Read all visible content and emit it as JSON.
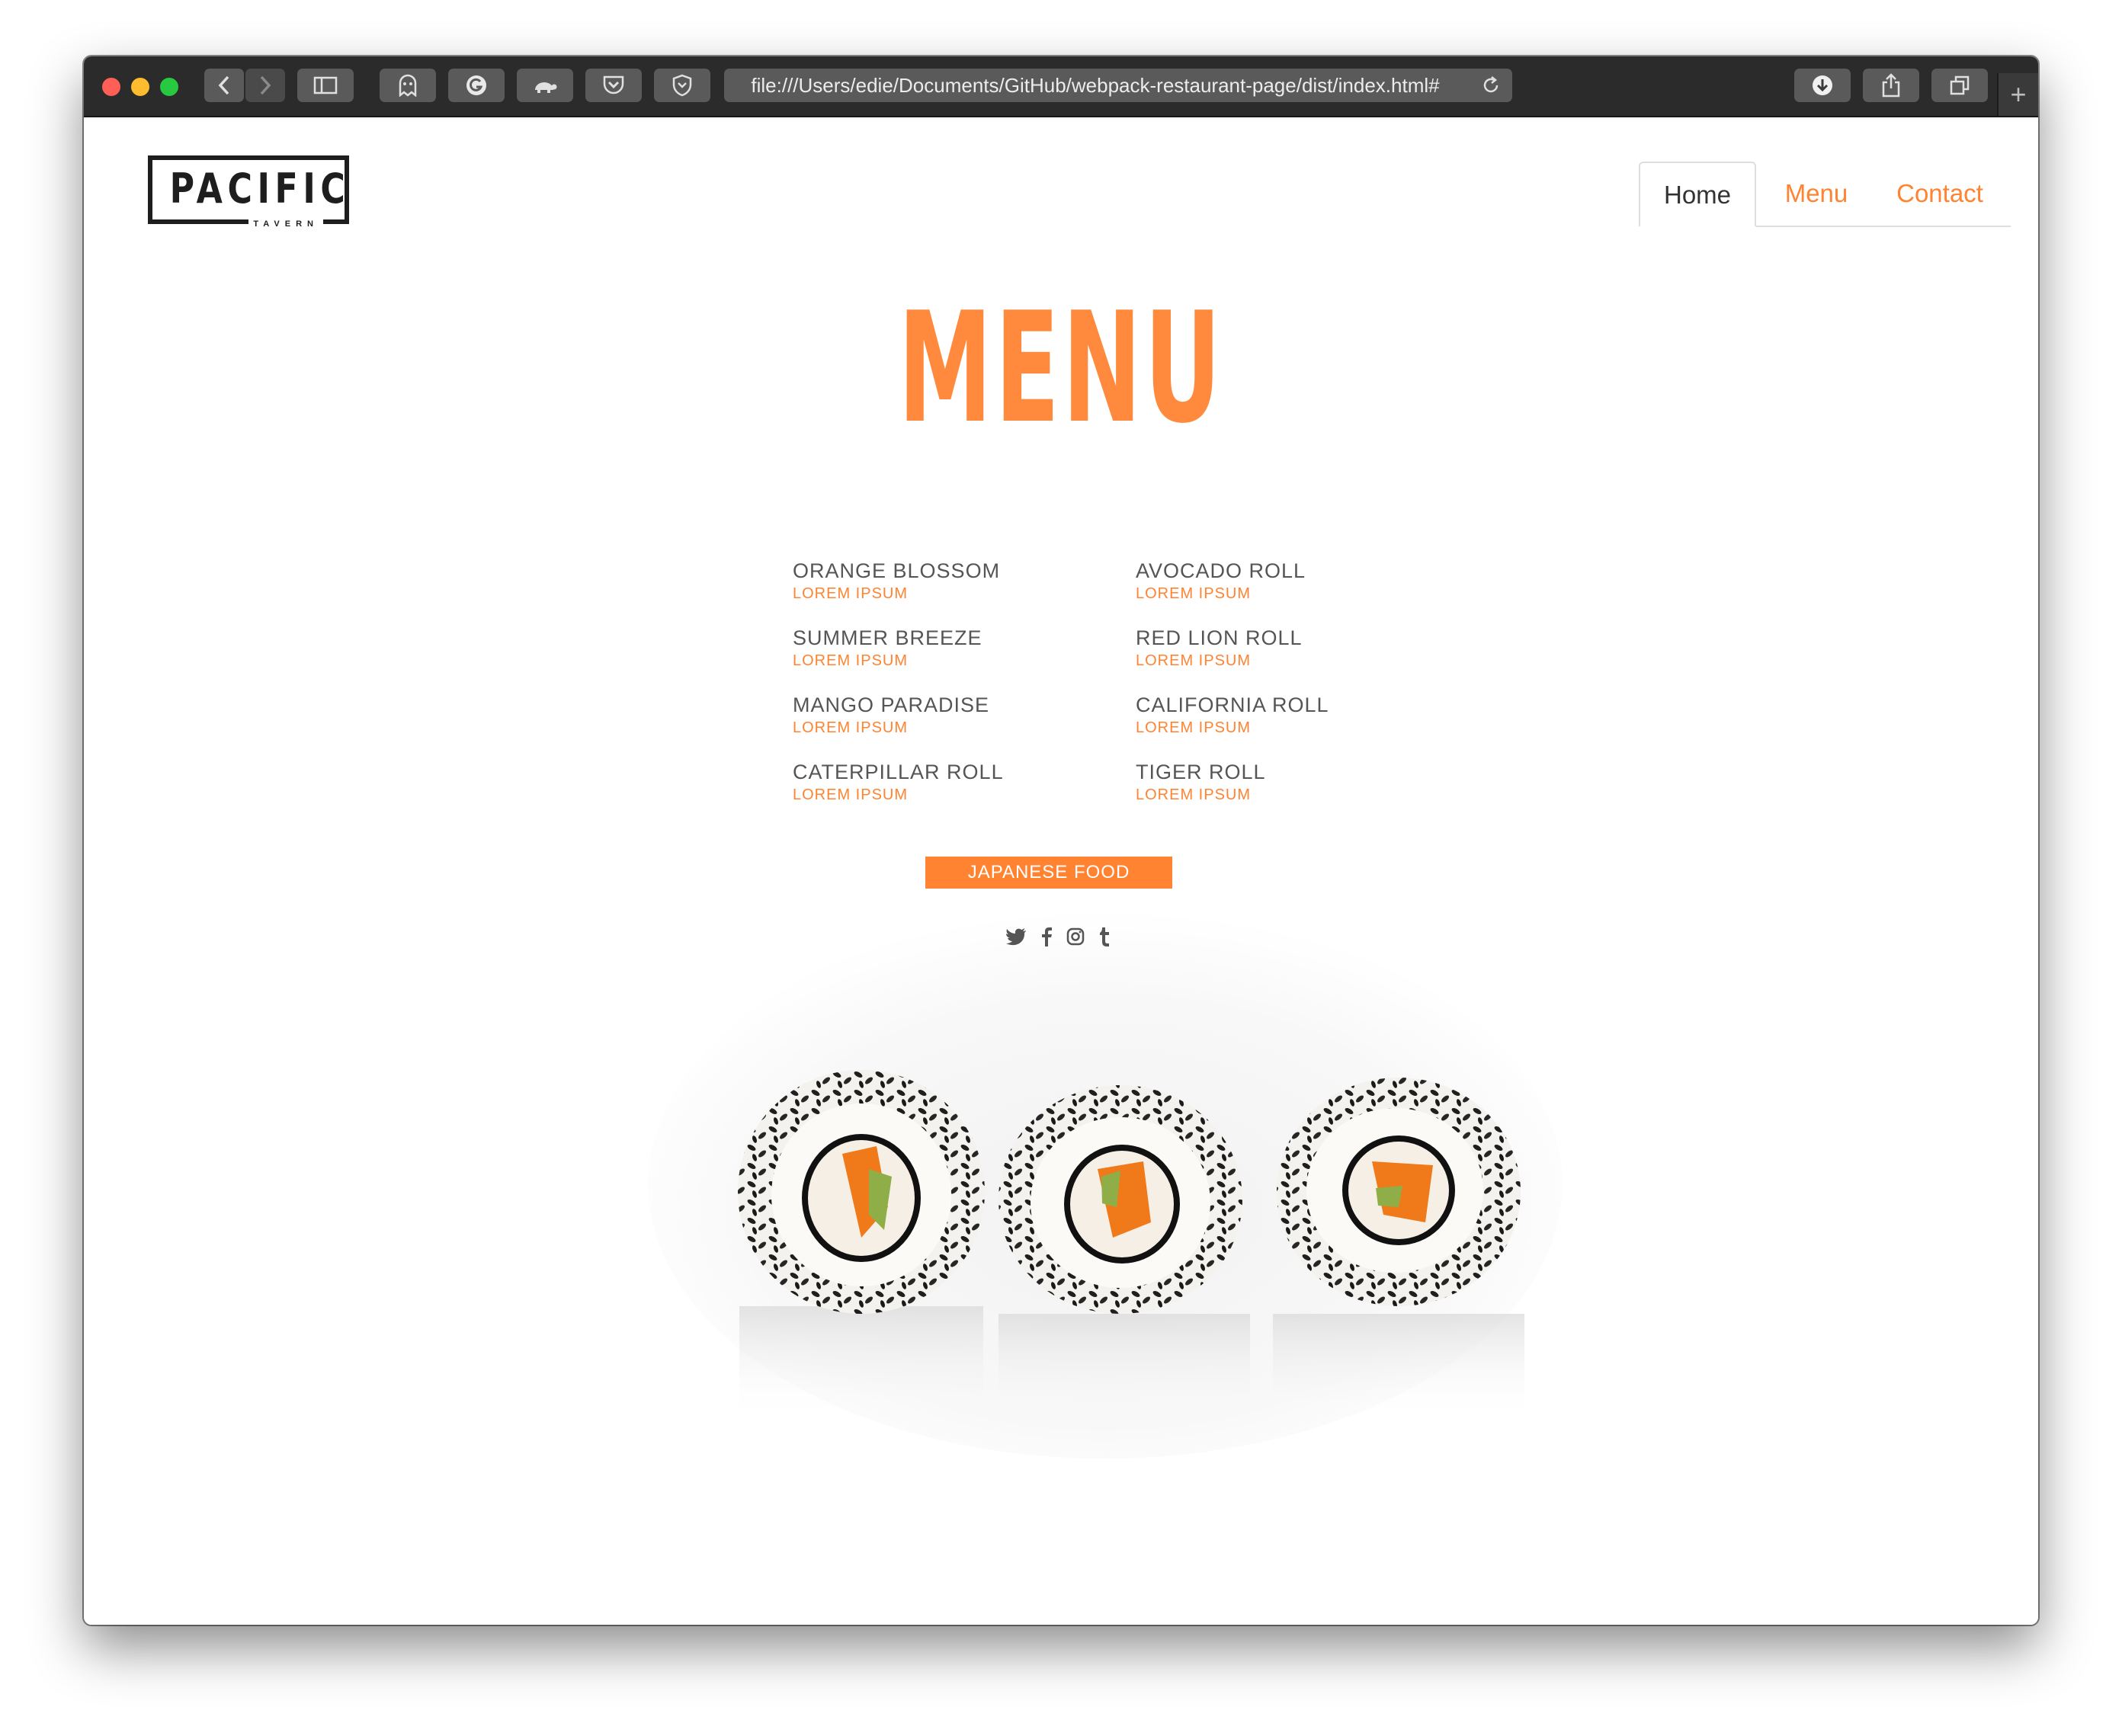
{
  "browser": {
    "url": "file:///Users/edie/Documents/GitHub/webpack-restaurant-page/dist/index.html#",
    "new_tab": "+"
  },
  "logo": {
    "name": "PACIFIC",
    "tagline": "TAVERN"
  },
  "nav": {
    "tabs": [
      {
        "label": "Home",
        "active": true
      },
      {
        "label": "Menu",
        "active": false
      },
      {
        "label": "Contact",
        "active": false
      }
    ]
  },
  "menu": {
    "title": "MENU",
    "left_items": [
      {
        "name": "ORANGE BLOSSOM",
        "desc": "LOREM IPSUM"
      },
      {
        "name": "SUMMER BREEZE",
        "desc": "LOREM IPSUM"
      },
      {
        "name": "MANGO PARADISE",
        "desc": "LOREM IPSUM"
      },
      {
        "name": "CATERPILLAR ROLL",
        "desc": "LOREM IPSUM"
      }
    ],
    "right_items": [
      {
        "name": "AVOCADO ROLL",
        "desc": "LOREM IPSUM"
      },
      {
        "name": "RED LION ROLL",
        "desc": "LOREM IPSUM"
      },
      {
        "name": "CALIFORNIA ROLL",
        "desc": "LOREM IPSUM"
      },
      {
        "name": "TIGER ROLL",
        "desc": "LOREM IPSUM"
      }
    ],
    "badge": "JAPANESE FOOD"
  },
  "social": {
    "icons": [
      "twitter-icon",
      "facebook-icon",
      "instagram-icon",
      "tumblr-icon"
    ]
  },
  "colors": {
    "accent": "#ff8330",
    "text": "#555555",
    "toolbar": "#2b2b2b"
  }
}
